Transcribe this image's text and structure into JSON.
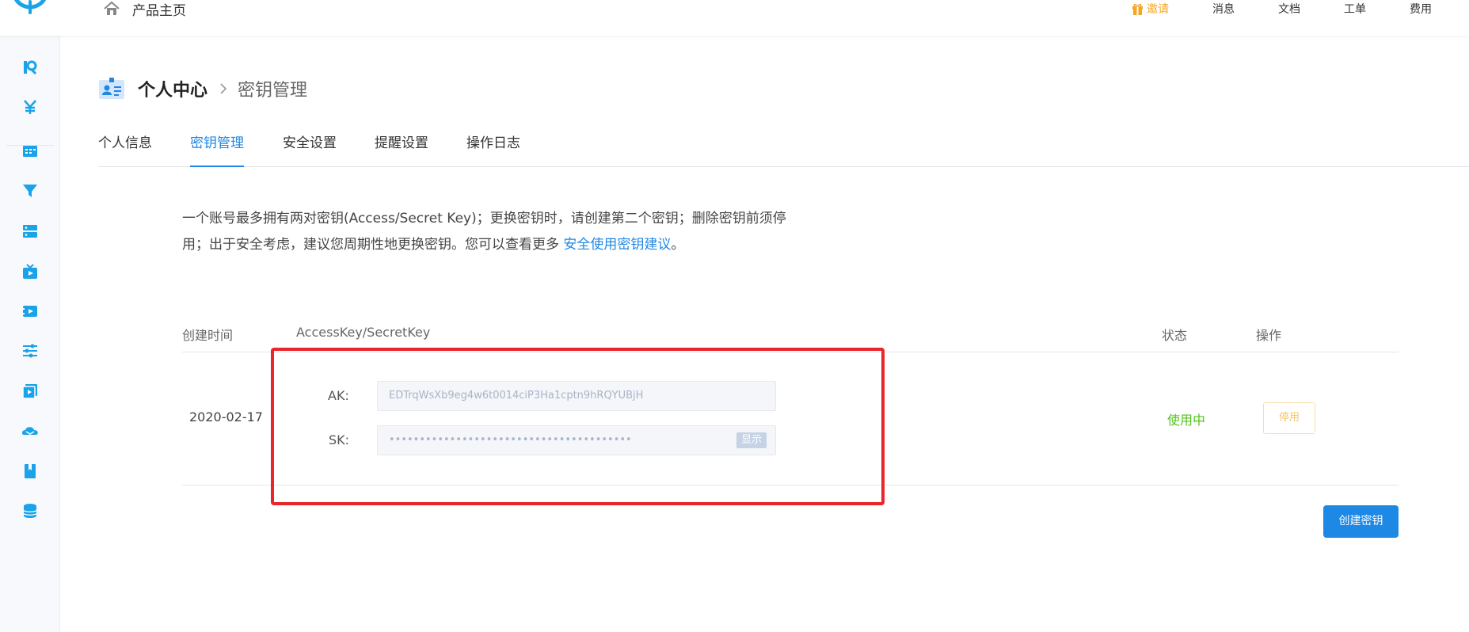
{
  "header": {
    "home_label": "产品主页",
    "nav": {
      "invite": "邀请",
      "messages": "消息",
      "docs": "文档",
      "tickets": "工单",
      "billing": "费用"
    }
  },
  "breadcrumb": {
    "parent": "个人中心",
    "current": "密钥管理"
  },
  "tabs": [
    {
      "label": "个人信息",
      "active": false
    },
    {
      "label": "密钥管理",
      "active": true
    },
    {
      "label": "安全设置",
      "active": false
    },
    {
      "label": "提醒设置",
      "active": false
    },
    {
      "label": "操作日志",
      "active": false
    }
  ],
  "description": {
    "text_line1": "一个账号最多拥有两对密钥(Access/Secret Key)；更换密钥时，请创建第二个密钥；删除密钥前须停",
    "text_line2": "用；出于安全考虑，建议您周期性地更换密钥。您可以查看更多 ",
    "link": "安全使用密钥建议",
    "suffix": "。"
  },
  "table": {
    "headers": {
      "created": "创建时间",
      "keys": "AccessKey/SecretKey",
      "status": "状态",
      "action": "操作"
    },
    "rows": [
      {
        "created": "2020-02-17",
        "ak_label": "AK:",
        "ak_value": "EDTrqWsXb9eg4w6t0014ciP3Ha1cptn9hRQYUBjH",
        "sk_label": "SK:",
        "sk_value": "••••••••••••••••••••••••••••••••••••••••",
        "show_label": "显示",
        "status": "使用中",
        "action_label": "停用"
      }
    ]
  },
  "create_button": "创建密钥",
  "colors": {
    "primary": "#1e88e5",
    "success": "#52c41a",
    "warning": "#f5a623",
    "highlight": "#e8262b"
  }
}
